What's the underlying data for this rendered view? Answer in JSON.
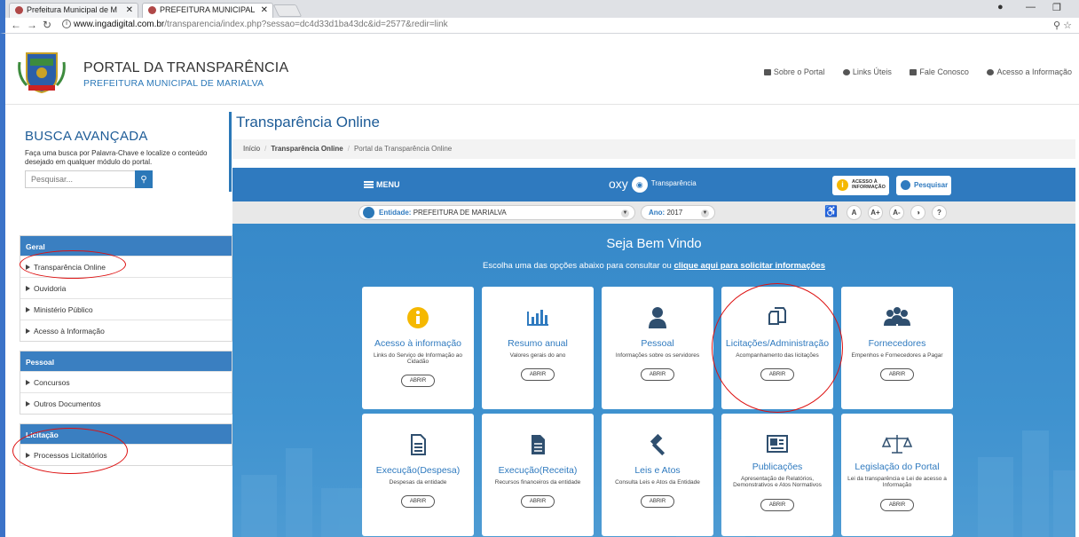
{
  "browser": {
    "tabs": [
      {
        "title": "Prefeitura Municipal de M"
      },
      {
        "title": "PREFEITURA MUNICIPAL"
      }
    ],
    "url_host": "www.ingadigital.com.br",
    "url_path": "/transparencia/index.php?sessao=dc4d33d1ba43dc&id=2577&redir=link"
  },
  "header": {
    "title": "PORTAL DA TRANSPARÊNCIA",
    "subtitle": "PREFEITURA MUNICIPAL DE MARIALVA",
    "links": [
      "Sobre o Portal",
      "Links Úteis",
      "Fale Conosco",
      "Acesso a Informação"
    ]
  },
  "sidebar": {
    "busca_title": "BUSCA AVANÇADA",
    "busca_desc": "Faça uma busca por Palavra-Chave e localize o conteúdo desejado em qualquer módulo do portal.",
    "search_placeholder": "Pesquisar...",
    "groups": [
      {
        "title": "Geral",
        "items": [
          "Transparência Online",
          "Ouvidoria",
          "Ministério Público",
          "Acesso à Informação"
        ]
      },
      {
        "title": "Pessoal",
        "items": [
          "Concursos",
          "Outros Documentos"
        ]
      },
      {
        "title": "Licitação",
        "items": [
          "Processos Licitatórios"
        ]
      }
    ]
  },
  "main": {
    "title": "Transparência Online",
    "breadcrumb": [
      "Início",
      "Transparência Online",
      "Portal da Transparência Online"
    ],
    "menu_label": "MENU",
    "oxy_brand": "oxy",
    "oxy_sub": "Transparência",
    "acesso_btn": "ACESSO À INFORMAÇÃO",
    "pesquisar_btn": "Pesquisar",
    "entidade_label": "Entidade:",
    "entidade_value": "PREFEITURA DE MARIALVA",
    "ano_label": "Ano:",
    "ano_value": "2017",
    "acc_buttons": [
      "A",
      "A+",
      "A-",
      "?"
    ],
    "welcome_title": "Seja Bem Vindo",
    "welcome_sub": "Escolha uma das opções abaixo para consultar ou",
    "welcome_link": "clique aqui para solicitar informações",
    "abrir_label": "ABRIR",
    "cards": [
      {
        "title": "Acesso à informação",
        "desc": "Links do Serviço de Informação ao Cidadão",
        "icon": "info-icon"
      },
      {
        "title": "Resumo anual",
        "desc": "Valores gerais do ano",
        "icon": "bar-chart-icon"
      },
      {
        "title": "Pessoal",
        "desc": "Informações sobre os servidores",
        "icon": "user-icon"
      },
      {
        "title": "Licitações/Administração",
        "desc": "Acompanhamento das licitações",
        "icon": "documents-icon"
      },
      {
        "title": "Fornecedores",
        "desc": "Empenhos e Fornecedores a Pagar",
        "icon": "group-icon"
      },
      {
        "title": "Execução(Despesa)",
        "desc": "Despesas da entidade",
        "icon": "document-outline-icon"
      },
      {
        "title": "Execução(Receita)",
        "desc": "Recursos financeiros da entidade",
        "icon": "document-filled-icon"
      },
      {
        "title": "Leis e Atos",
        "desc": "Consulta Leis e Atos da Entidade",
        "icon": "gavel-icon"
      },
      {
        "title": "Publicações",
        "desc": "Apresentação de Relatórios, Demonstrativos e Atos Normativos",
        "icon": "newspaper-icon"
      },
      {
        "title": "Legislação do Portal",
        "desc": "Lei da transparência e Lei de acesso a Informação",
        "icon": "scales-icon"
      }
    ]
  }
}
